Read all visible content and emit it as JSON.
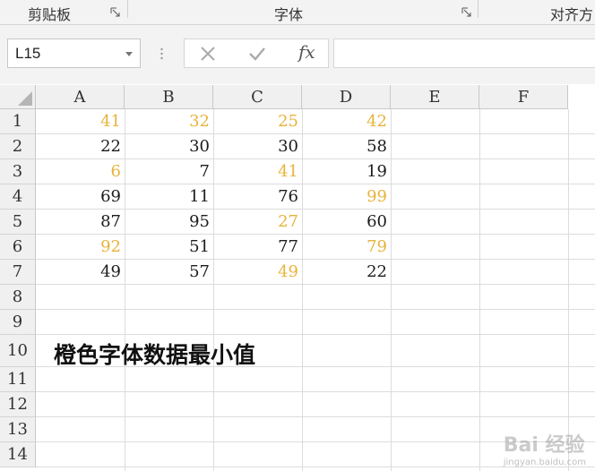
{
  "ribbon": {
    "groups": [
      {
        "label": "剪贴板"
      },
      {
        "label": "字体"
      },
      {
        "label": "对齐方"
      }
    ]
  },
  "formula_bar": {
    "name_box_value": "L15",
    "fx_label": "fx",
    "formula_value": ""
  },
  "sheet": {
    "columns": [
      "A",
      "B",
      "C",
      "D",
      "E",
      "F"
    ],
    "rows": [
      "1",
      "2",
      "3",
      "4",
      "5",
      "6",
      "7",
      "8",
      "9",
      "10",
      "11",
      "12",
      "13",
      "14"
    ],
    "cells": [
      [
        {
          "v": "41",
          "orange": true
        },
        {
          "v": "32",
          "orange": true
        },
        {
          "v": "25",
          "orange": true
        },
        {
          "v": "42",
          "orange": true
        }
      ],
      [
        {
          "v": "22",
          "orange": false
        },
        {
          "v": "30",
          "orange": false
        },
        {
          "v": "30",
          "orange": false
        },
        {
          "v": "58",
          "orange": false
        }
      ],
      [
        {
          "v": "6",
          "orange": true
        },
        {
          "v": "7",
          "orange": false
        },
        {
          "v": "41",
          "orange": true
        },
        {
          "v": "19",
          "orange": false
        }
      ],
      [
        {
          "v": "69",
          "orange": false
        },
        {
          "v": "11",
          "orange": false
        },
        {
          "v": "76",
          "orange": false
        },
        {
          "v": "99",
          "orange": true
        }
      ],
      [
        {
          "v": "87",
          "orange": false
        },
        {
          "v": "95",
          "orange": false
        },
        {
          "v": "27",
          "orange": true
        },
        {
          "v": "60",
          "orange": false
        }
      ],
      [
        {
          "v": "92",
          "orange": true
        },
        {
          "v": "51",
          "orange": false
        },
        {
          "v": "77",
          "orange": false
        },
        {
          "v": "79",
          "orange": true
        }
      ],
      [
        {
          "v": "49",
          "orange": false
        },
        {
          "v": "57",
          "orange": false
        },
        {
          "v": "49",
          "orange": true
        },
        {
          "v": "22",
          "orange": false
        }
      ]
    ],
    "caption": "橙色字体数据最小值"
  },
  "watermark": {
    "brand": "Bai 经验",
    "url": "jingyan.baidu.com"
  },
  "colors": {
    "orange_text": "#e8b33a",
    "header_bg": "#f0f0f0",
    "gridline": "#dcdcdc"
  }
}
